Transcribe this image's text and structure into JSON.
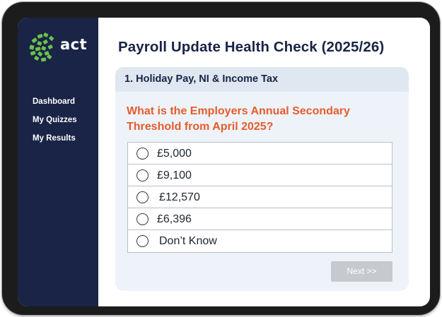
{
  "brand": {
    "name": "act",
    "logo_color": "#6cc24a"
  },
  "sidebar": {
    "items": [
      {
        "label": "Dashboard"
      },
      {
        "label": "My Quizzes"
      },
      {
        "label": "My Results"
      }
    ]
  },
  "quiz": {
    "title": "Payroll Update Health Check (2025/26)",
    "section": "1.  Holiday Pay, NI & Income Tax",
    "question": "What is the Employers Annual Secondary Threshold from April 2025?",
    "options": [
      {
        "label": "£5,000",
        "selected": false
      },
      {
        "label": "£9,100",
        "selected": false
      },
      {
        "label": "£12,570",
        "selected": false
      },
      {
        "label": "£6,396",
        "selected": false
      },
      {
        "label": "Don’t Know",
        "selected": false
      }
    ],
    "next_label": "Next >>"
  },
  "colors": {
    "sidebar_bg": "#192446",
    "question_text": "#e65c2b",
    "card_bg": "#eef3fa",
    "button_disabled": "#c6cacf"
  }
}
